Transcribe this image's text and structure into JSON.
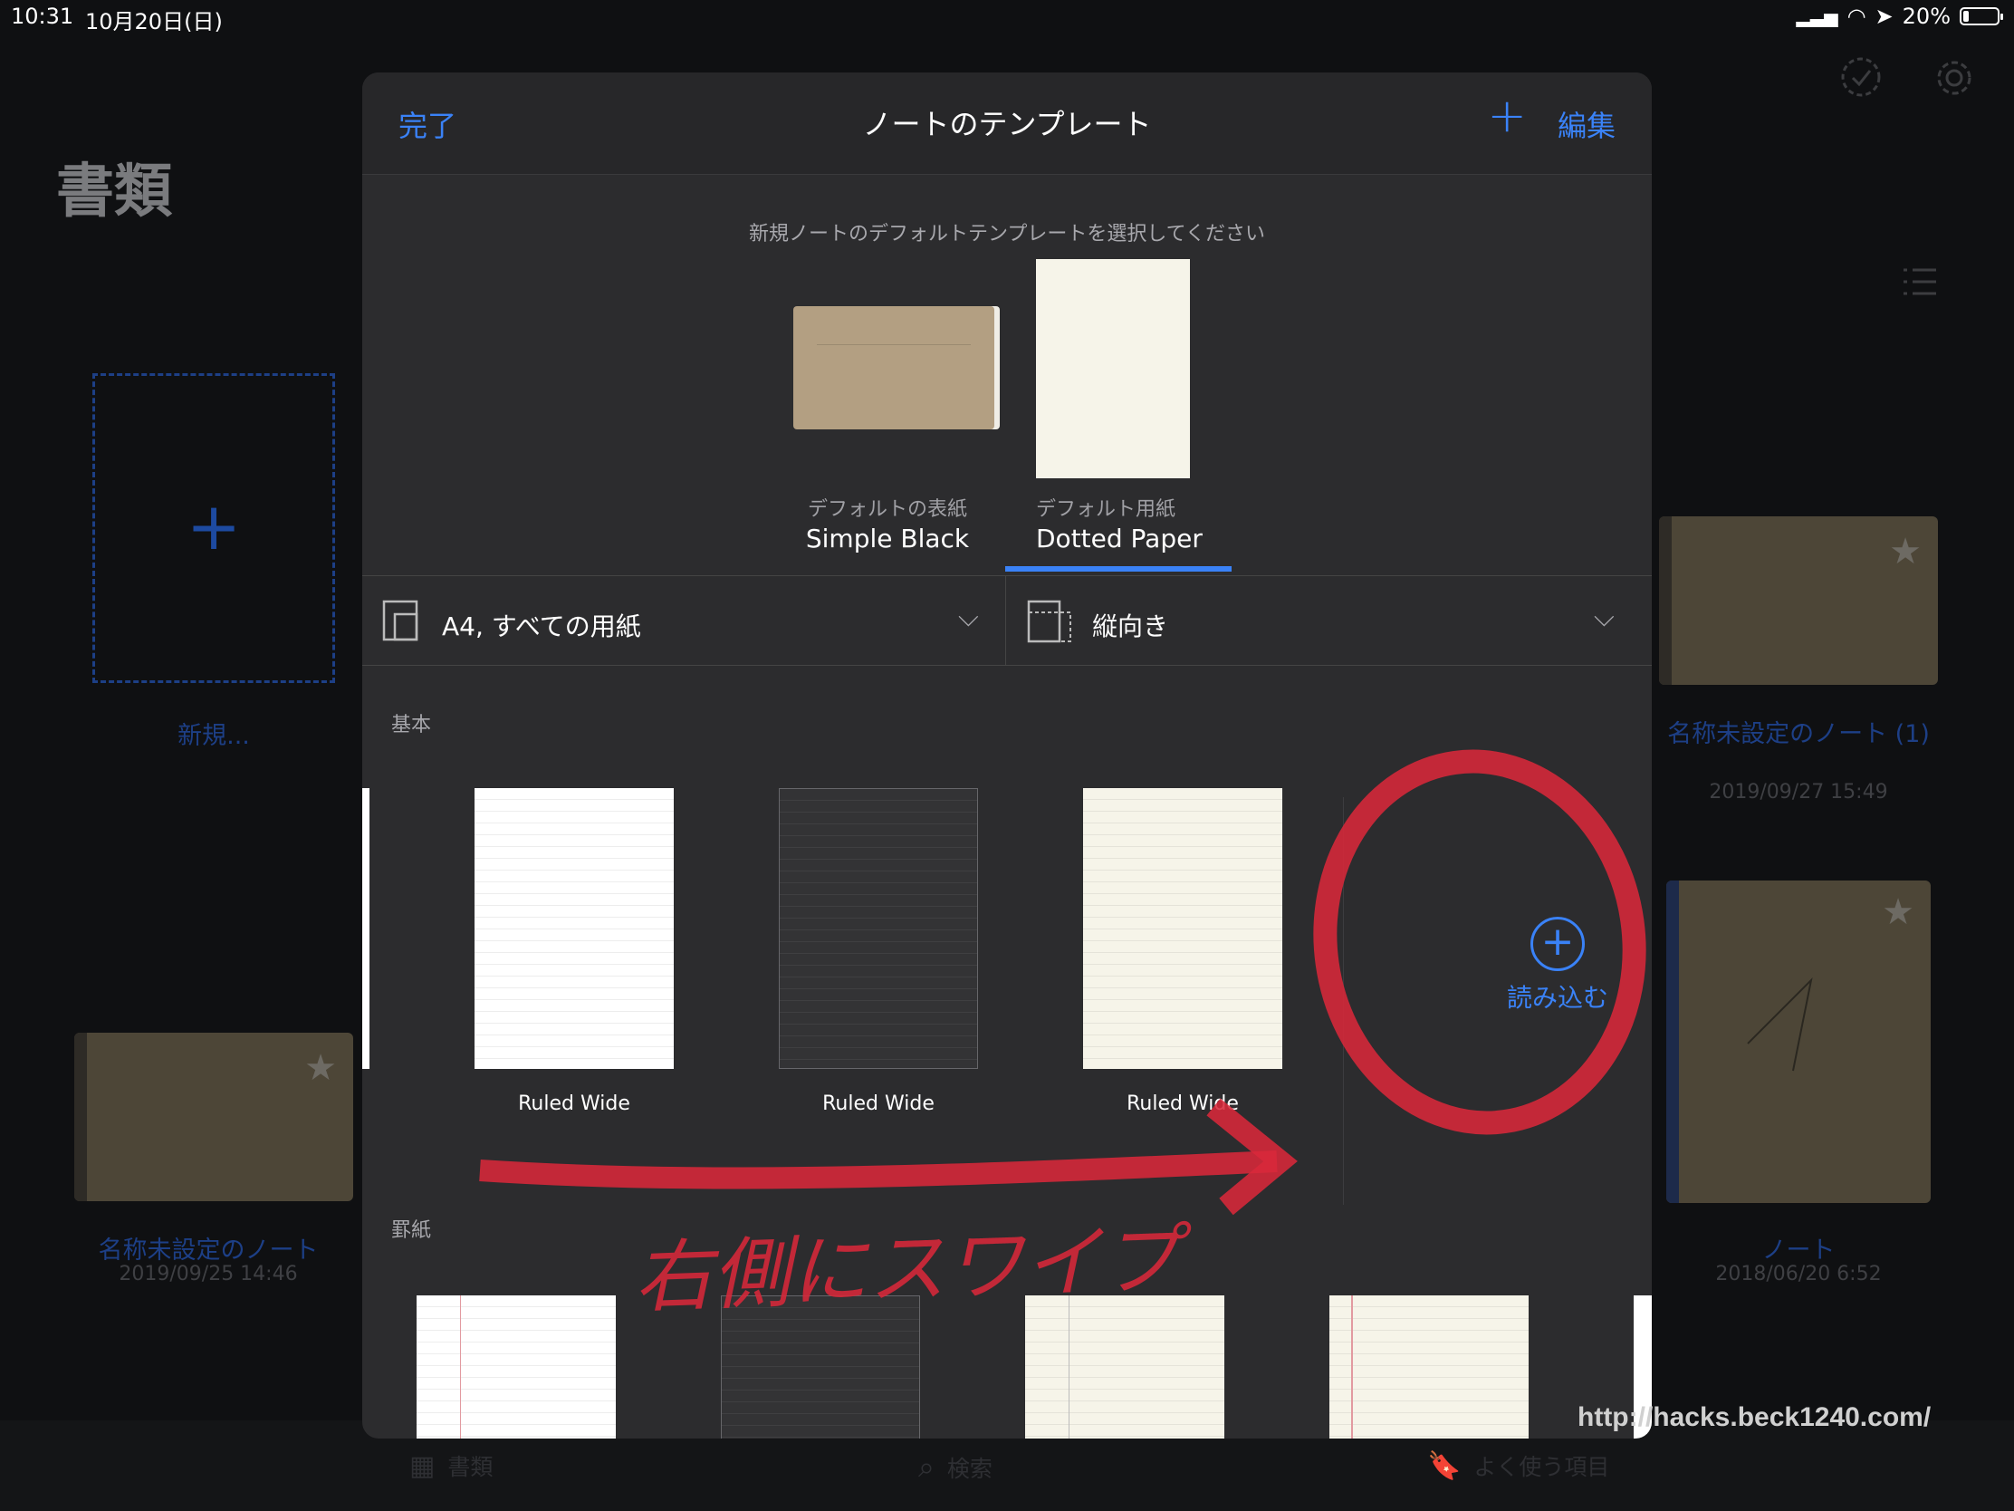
{
  "status_bar": {
    "time": "10:31",
    "date": "10月20日(日)",
    "battery": "20%",
    "battery_level": 0.2
  },
  "library": {
    "title": "書類",
    "new_label": "新規...",
    "notebooks": [
      {
        "name": "名称未設定のノート",
        "date": "2019/09/25 14:46"
      },
      {
        "name": "名称未設定のノート (1)",
        "date": "2019/09/27 15:49"
      },
      {
        "name": "ノート",
        "date": "2018/06/20 6:52"
      }
    ]
  },
  "tabbar": {
    "items": [
      "書類",
      "検索",
      "よく使う項目"
    ]
  },
  "modal": {
    "done": "完了",
    "title": "ノートのテンプレート",
    "edit": "編集",
    "subtitle": "新規ノートのデフォルトテンプレートを選択してください",
    "default_cover_label": "デフォルトの表紙",
    "default_cover_value": "Simple Black",
    "default_paper_label": "デフォルト用紙",
    "default_paper_value": "Dotted Paper",
    "paper_size": "A4, すべての用紙",
    "orientation": "縦向き",
    "section_basic": "基本",
    "section_ruled": "罫紙",
    "templates": [
      "Ruled Wide",
      "Ruled Wide",
      "Ruled Wide"
    ],
    "import_label": "読み込む"
  },
  "annotation": {
    "text": "右側にスワイプ",
    "color": "#d8283a"
  },
  "watermark": "http://hacks.beck1240.com/",
  "colors": {
    "accent": "#3a82f7",
    "modal_bg": "#2c2c2e"
  }
}
